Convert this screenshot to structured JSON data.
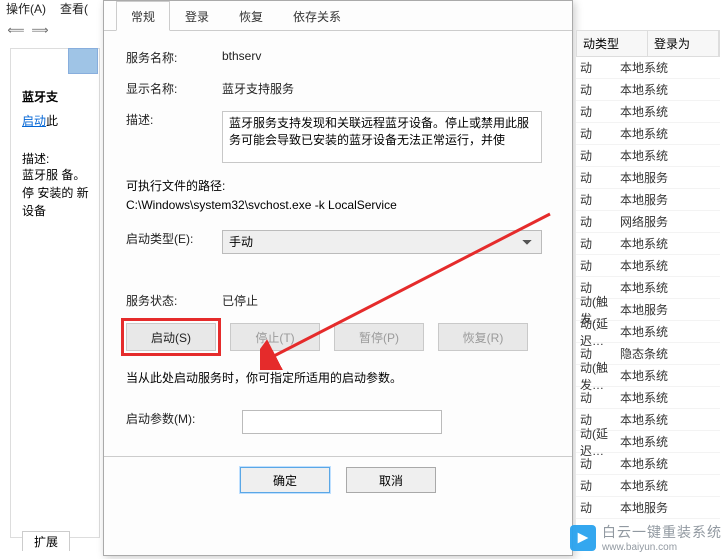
{
  "toolbar": {
    "ops": "操作(A)",
    "view": "查看("
  },
  "left": {
    "title": "蓝牙支",
    "start_link": "启动",
    "start_tail": "此",
    "desc_hdr": "描述:",
    "desc_txt": "蓝牙服\n备。停\n安装的\n新设备",
    "ext_tab": "扩展"
  },
  "dialog": {
    "tabs": {
      "general": "常规",
      "logon": "登录",
      "recovery": "恢复",
      "deps": "依存关系"
    },
    "service_name_lbl": "服务名称:",
    "service_name": "bthserv",
    "display_name_lbl": "显示名称:",
    "display_name": "蓝牙支持服务",
    "desc_lbl": "描述:",
    "desc": "蓝牙服务支持发现和关联远程蓝牙设备。停止或禁用此服务可能会导致已安装的蓝牙设备无法正常运行，并使",
    "path_lbl": "可执行文件的路径:",
    "path": "C:\\Windows\\system32\\svchost.exe -k LocalService",
    "startup_lbl": "启动类型(E):",
    "startup_val": "手动",
    "status_lbl": "服务状态:",
    "status_val": "已停止",
    "btn_start": "启动(S)",
    "btn_stop": "停止(T)",
    "btn_pause": "暂停(P)",
    "btn_resume": "恢复(R)",
    "hint": "当从此处启动服务时，你可指定所适用的启动参数。",
    "param_lbl": "启动参数(M):",
    "ok": "确定",
    "cancel": "取消"
  },
  "right": {
    "hdr_startup": "动类型",
    "hdr_logon": "登录为",
    "rows": [
      {
        "s": "动",
        "l": "本地系统"
      },
      {
        "s": "动",
        "l": "本地系统"
      },
      {
        "s": "动",
        "l": "本地系统"
      },
      {
        "s": "动",
        "l": "本地系统"
      },
      {
        "s": "动",
        "l": "本地系统"
      },
      {
        "s": "动",
        "l": "本地服务"
      },
      {
        "s": "动",
        "l": "本地服务"
      },
      {
        "s": "动",
        "l": "网络服务"
      },
      {
        "s": "动",
        "l": "本地系统"
      },
      {
        "s": "动",
        "l": "本地系统"
      },
      {
        "s": "动",
        "l": "本地系统"
      },
      {
        "s": "动(触发…",
        "l": "本地服务"
      },
      {
        "s": "动(延迟…",
        "l": "本地系统"
      },
      {
        "s": "动",
        "l": "隐态条统"
      },
      {
        "s": "动(触发…",
        "l": "本地系统"
      },
      {
        "s": "动",
        "l": "本地系统"
      },
      {
        "s": "动",
        "l": "本地系统"
      },
      {
        "s": "动(延迟…",
        "l": "本地系统"
      },
      {
        "s": "动",
        "l": "本地系统"
      },
      {
        "s": "动",
        "l": "本地系统"
      },
      {
        "s": "动",
        "l": "本地服务"
      }
    ]
  },
  "watermark": {
    "brand": "白云一键重装系统",
    "url": "www.baiyun.com"
  }
}
